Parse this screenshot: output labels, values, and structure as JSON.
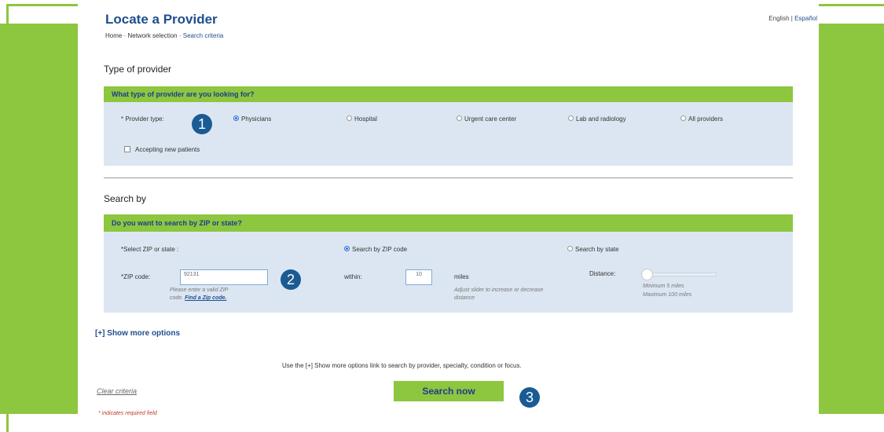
{
  "header": {
    "title": "Locate a Provider",
    "breadcrumb": [
      "Home",
      "Network selection",
      "Search criteria"
    ],
    "breadcrumb_sep": "·",
    "lang_english": "English",
    "lang_sep": "|",
    "lang_spanish": "Español"
  },
  "provider_section": {
    "heading": "Type of provider",
    "question": "What type of provider are you looking for?",
    "field_label": "* Provider type:",
    "options": [
      "Physicians",
      "Hospital",
      "Urgent care center",
      "Lab and radiology",
      "All providers"
    ],
    "selected": "Physicians",
    "accepting_label": "Accepting new patients"
  },
  "search_section": {
    "heading": "Search by",
    "question": "Do you want to search by ZIP or state?",
    "select_label": "*Select ZIP or state :",
    "option_zip": "Search by ZIP code",
    "option_state": "Search by state",
    "selected": "Search by ZIP code",
    "zip_label": "*ZIP code:",
    "zip_value": "92131",
    "zip_help": "Please enter a valid ZIP code.",
    "zip_link": "Find a Zip code.",
    "within_label": "within:",
    "within_value": "10",
    "miles_label": "miles",
    "miles_help": "Adjust slider to increase or decrease distance",
    "distance_label": "Distance:",
    "distance_min": "Minimum 5 miles",
    "distance_max": "Maximum 100 miles"
  },
  "show_more": "[+] Show more options",
  "hint": "Use the [+] Show more options link to search by provider, specialty, condition or focus.",
  "clear_label": "Clear criteria",
  "search_button": "Search now",
  "required_note": "* indicates required field",
  "badges": [
    "1",
    "2",
    "3"
  ],
  "colors": {
    "accent_green": "#8dc63f",
    "brand_blue": "#1f4e8c",
    "panel_bg": "#dce6f2",
    "badge_blue": "#1a5b94"
  }
}
